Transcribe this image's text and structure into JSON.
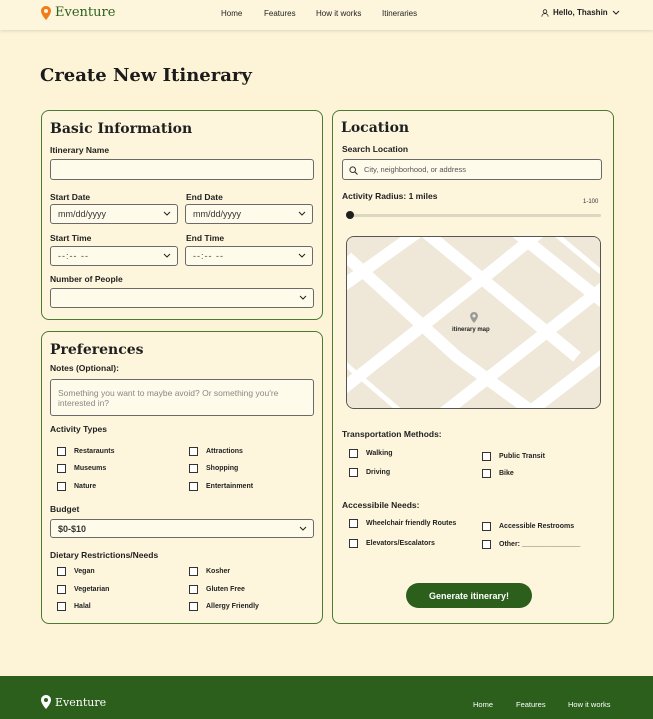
{
  "brand": {
    "name": "Eventure",
    "primary_color": "#2c5f1c",
    "accent_color": "#f07d1a",
    "bg_color": "#fdf3d6"
  },
  "header": {
    "nav": [
      "Home",
      "Features",
      "How it works",
      "Itineraries"
    ],
    "user_greeting": "Hello, Thashin"
  },
  "page_title": "Create New Itinerary",
  "basic_info": {
    "title": "Basic Information",
    "itinerary_name_label": "Itinerary Name",
    "start_date_label": "Start Date",
    "start_date_value": "mm/dd/yyyy",
    "end_date_label": "End Date",
    "end_date_value": "mm/dd/yyyy",
    "start_time_label": "Start Time",
    "start_time_value": "--:-- --",
    "end_time_label": "End Time",
    "end_time_value": "--:-- --",
    "people_label": "Number of People"
  },
  "preferences": {
    "title": "Preferences",
    "notes_label": "Notes (Optional):",
    "notes_placeholder": "Something you want to maybe avoid? Or something you're interested in?",
    "activity_label": "Activity Types",
    "activity_left": [
      "Restaraunts",
      "Museums",
      "Nature"
    ],
    "activity_right": [
      "Attractions",
      "Shopping",
      "Entertainment"
    ],
    "budget_label": "Budget",
    "budget_value": "$0-$10",
    "dietary_label": "Dietary Restrictions/Needs",
    "dietary_left": [
      "Vegan",
      "Vegetarian",
      "Halal"
    ],
    "dietary_right": [
      "Kosher",
      "Gluten Free",
      "Allergy Friendly"
    ]
  },
  "location": {
    "title": "Location",
    "search_label": "Search Location",
    "search_placeholder": "City, neighborhood, or address",
    "radius_label": "Activity Radius: 1 miles",
    "radius_range": "1-100",
    "radius_value": 1,
    "map_label": "itinerary map",
    "transport_label": "Transportation Methods:",
    "transport_left": [
      "Walking",
      "Driving"
    ],
    "transport_right": [
      "Public Transit",
      "Bike"
    ],
    "access_label": "Accessibile Needs:",
    "access_left": [
      "Wheelchair friendly Routes",
      "Elevators/Escalators"
    ],
    "access_right": [
      "Accessible Restrooms",
      "Other: _______________"
    ],
    "generate_button": "Generate itinerary!"
  },
  "footer": {
    "name": "Eventure",
    "nav": [
      "Home",
      "Features",
      "How it works"
    ]
  }
}
